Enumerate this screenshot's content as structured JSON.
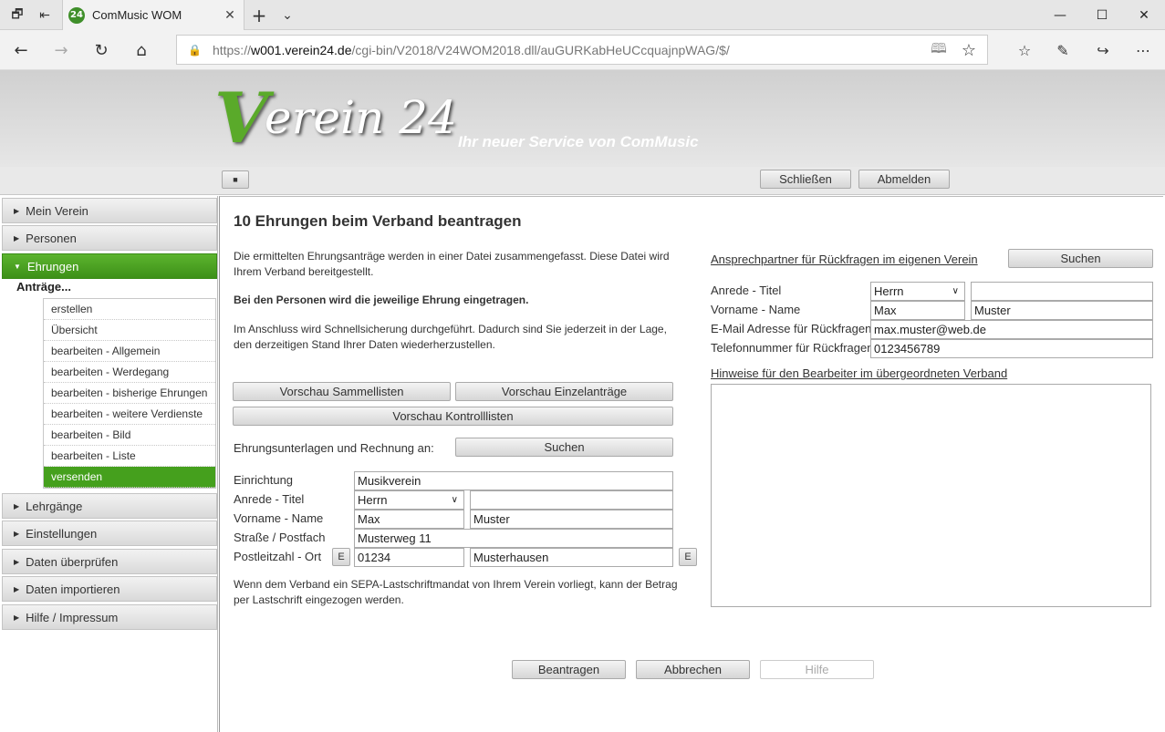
{
  "browser": {
    "tab_title": "ComMusic WOM",
    "favicon_text": "24",
    "url_prefix": "https://",
    "url_host": "w001.verein24.de",
    "url_path": "/cgi-bin/V2018/V24WOM2018.dll/auGURKabHeUCcquajnpWAG/$/"
  },
  "header": {
    "logo_v": "V",
    "logo_rest": "erein 24",
    "tagline": "Ihr neuer Service von ComMusic"
  },
  "toolbar": {
    "close_label": "Schließen",
    "logout_label": "Abmelden"
  },
  "sidebar": {
    "sections": [
      "Mein Verein",
      "Personen",
      "Ehrungen",
      "Lehrgänge",
      "Einstellungen",
      "Daten überprüfen",
      "Daten importieren",
      "Hilfe / Impressum"
    ],
    "active_section": "Ehrungen",
    "group_title": "Anträge...",
    "sub_items": [
      "erstellen",
      "Übersicht",
      "bearbeiten - Allgemein",
      "bearbeiten - Werdegang",
      "bearbeiten - bisherige Ehrungen",
      "bearbeiten - weitere Verdienste",
      "bearbeiten - Bild",
      "bearbeiten - Liste",
      "versenden"
    ],
    "active_sub_item": "versenden"
  },
  "main": {
    "title": "10 Ehrungen beim Verband beantragen",
    "intro1": "Die ermittelten Ehrungsanträge werden in einer Datei zusammengefasst. Diese Datei wird Ihrem Verband bereitgestellt.",
    "intro2": "Bei den Personen wird die jeweilige Ehrung eingetragen.",
    "intro3": "Im Anschluss wird Schnellsicherung durchgeführt. Dadurch sind Sie jederzeit in der Lage, den derzeitigen Stand Ihrer Daten wiederherzustellen.",
    "btn_preview_collective": "Vorschau Sammellisten",
    "btn_preview_single": "Vorschau Einzelanträge",
    "btn_preview_control": "Vorschau Kontrolllisten",
    "recipient_label": "Ehrungsunterlagen und Rechnung an:",
    "search_label": "Suchen",
    "form": {
      "institution_label": "Einrichtung",
      "institution_value": "Musikverein",
      "salutation_label": "Anrede - Titel",
      "salutation_value": "Herrn",
      "title_value": "",
      "name_label": "Vorname - Name",
      "first_name": "Max",
      "last_name": "Muster",
      "street_label": "Straße / Postfach",
      "street_value": "Musterweg 11",
      "zip_label": "Postleitzahl - Ort",
      "zip_value": "01234",
      "city_value": "Musterhausen",
      "e_label": "E"
    },
    "sepa_note": "Wenn dem Verband ein SEPA-Lastschriftmandat von Ihrem Verein vorliegt, kann der Betrag per Lastschrift eingezogen werden.",
    "contact": {
      "heading": "Ansprechpartner für Rückfragen im eigenen Verein",
      "search_label": "Suchen",
      "salutation_label": "Anrede - Titel",
      "salutation_value": "Herrn",
      "title_value": "",
      "name_label": "Vorname - Name",
      "first_name": "Max",
      "last_name": "Muster",
      "email_label": "E-Mail Adresse für Rückfragen",
      "email_value": "max.muster@web.de",
      "phone_label": "Telefonnummer für Rückfragen",
      "phone_value": "0123456789"
    },
    "notes_heading": "Hinweise für den Bearbeiter im übergeordneten Verband",
    "notes_value": "",
    "btn_submit": "Beantragen",
    "btn_cancel": "Abbrechen",
    "btn_help": "Hilfe"
  }
}
